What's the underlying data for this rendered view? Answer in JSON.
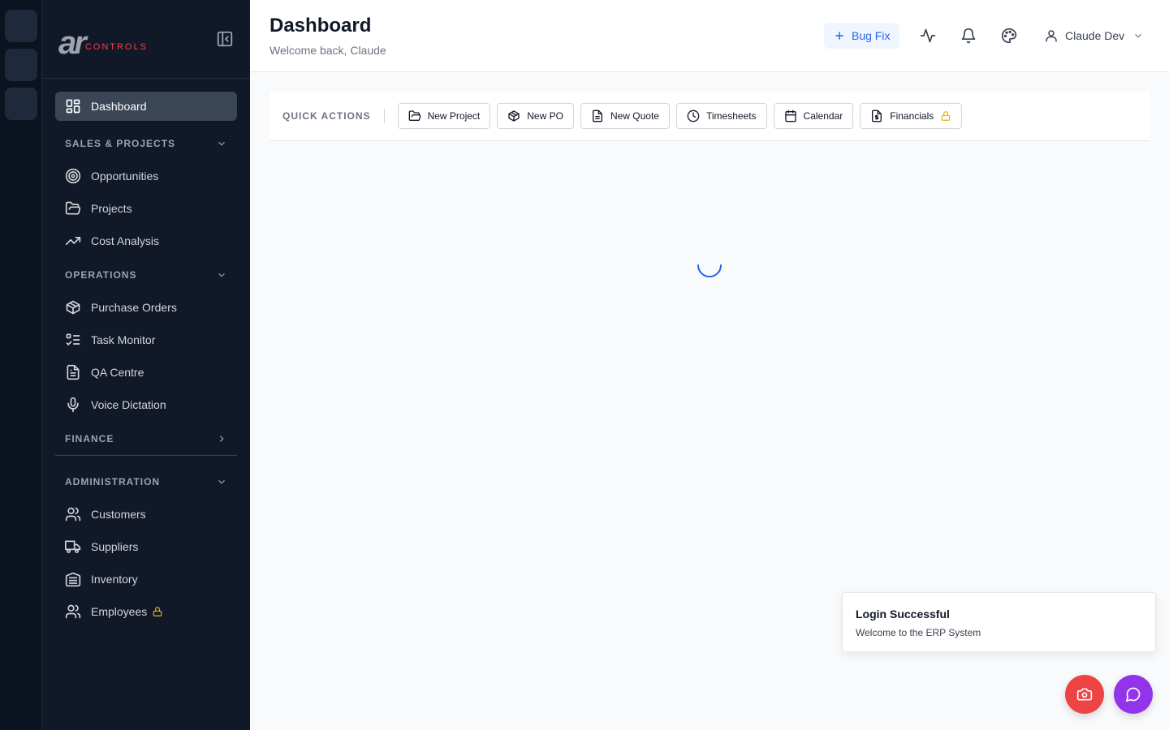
{
  "brand": {
    "logo_main": "ar",
    "logo_sub": "CONTROLS"
  },
  "sidebar": {
    "dashboard": "Dashboard",
    "sections": [
      {
        "title": "SALES & PROJECTS",
        "items": [
          "Opportunities",
          "Projects",
          "Cost Analysis"
        ]
      },
      {
        "title": "OPERATIONS",
        "items": [
          "Purchase Orders",
          "Task Monitor",
          "QA Centre",
          "Voice Dictation"
        ]
      },
      {
        "title": "FINANCE",
        "items": []
      },
      {
        "title": "ADMINISTRATION",
        "items": [
          "Customers",
          "Suppliers",
          "Inventory",
          "Employees"
        ]
      }
    ]
  },
  "header": {
    "title": "Dashboard",
    "subtitle": "Welcome back, Claude",
    "bug_fix_label": "Bug Fix",
    "user_name": "Claude Dev"
  },
  "quick_actions": {
    "label": "QUICK ACTIONS",
    "buttons": [
      "New Project",
      "New PO",
      "New Quote",
      "Timesheets",
      "Calendar",
      "Financials"
    ]
  },
  "toast": {
    "title": "Login Successful",
    "message": "Welcome to the ERP System"
  },
  "colors": {
    "sidebar_bg": "#111827",
    "rail_bg": "#0b1220",
    "accent_blue": "#2563eb",
    "lock_yellow": "#eab308",
    "fab_red": "#ef4444",
    "fab_purple": "#9333ea"
  },
  "icons": {
    "sidebar": [
      "dashboard-grid-icon",
      "target-icon",
      "folder-open-icon",
      "trending-up-icon",
      "package-icon",
      "list-checks-icon",
      "file-text-icon",
      "microphone-icon",
      "users-icon",
      "truck-icon",
      "warehouse-icon",
      "users-icon"
    ],
    "header": [
      "plus-icon",
      "activity-icon",
      "bell-icon",
      "palette-icon",
      "user-icon",
      "chevron-down-icon"
    ],
    "fabs": [
      "camera-icon",
      "message-circle-icon"
    ]
  }
}
